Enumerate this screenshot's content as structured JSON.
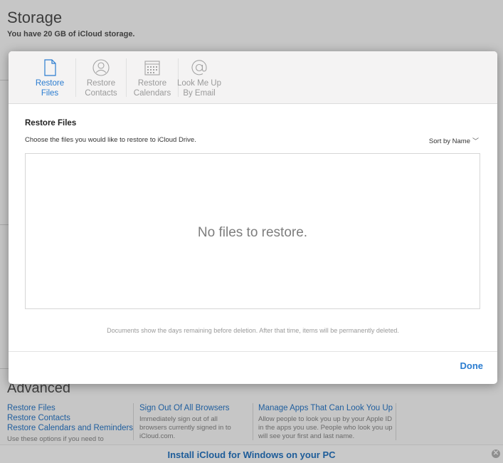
{
  "background": {
    "title": "Storage",
    "subtitle": "You have 20 GB of iCloud storage.",
    "advanced": {
      "title": "Advanced",
      "col1": {
        "links": [
          "Restore Files",
          "Restore Contacts",
          "Restore Calendars and Reminders"
        ],
        "desc": "Use these options if you need to"
      },
      "col2": {
        "link": "Sign Out Of All Browsers",
        "desc": "Immediately sign out of all browsers currently signed in to iCloud.com."
      },
      "col3": {
        "link": "Manage Apps That Can Look You Up",
        "desc": "Allow people to look you up by your Apple ID in the apps you use. People who look you up will see your first and last name."
      }
    },
    "install_bar": {
      "text": "Install iCloud for Windows on your PC",
      "close_icon": "close-circle-icon"
    }
  },
  "modal": {
    "tabs": [
      {
        "line1": "Restore",
        "line2": "Files",
        "icon": "document-icon",
        "active": true
      },
      {
        "line1": "Restore",
        "line2": "Contacts",
        "icon": "contact-icon",
        "active": false
      },
      {
        "line1": "Restore",
        "line2": "Calendars",
        "icon": "calendar-icon",
        "active": false
      },
      {
        "line1": "Look Me Up",
        "line2": "By Email",
        "icon": "at-sign-icon",
        "active": false
      }
    ],
    "section_title": "Restore Files",
    "section_desc": "Choose the files you would like to restore to iCloud Drive.",
    "sort_label": "Sort by Name",
    "empty_message": "No files to restore.",
    "footnote": "Documents show the days remaining before deletion. After that time, items will be permanently deleted.",
    "done_label": "Done"
  },
  "colors": {
    "accent": "#2a7cd0",
    "link": "#1f5e9e",
    "storage_bar": "#e5a44a"
  }
}
